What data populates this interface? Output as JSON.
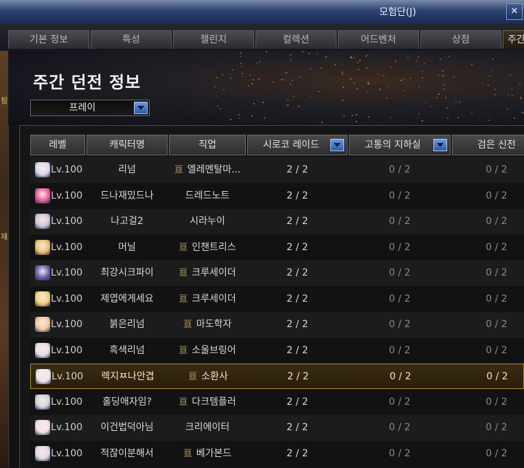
{
  "window": {
    "title": "모험단(J)"
  },
  "tabs": [
    {
      "label": "기본 정보"
    },
    {
      "label": "특성"
    },
    {
      "label": "챌린지"
    },
    {
      "label": "컬렉션"
    },
    {
      "label": "어드벤처"
    },
    {
      "label": "상점"
    },
    {
      "label": "주간"
    }
  ],
  "page": {
    "heading": "주간 던전 정보",
    "filter": {
      "selected": "프레이"
    }
  },
  "table": {
    "columns": [
      "레벨",
      "캐릭터명",
      "직업",
      "시로코 레이드",
      "고통의 지하실",
      "검은 신전"
    ],
    "rows": [
      {
        "level": "Lv.100",
        "name": "리넘",
        "job": "엘레멘탈마...",
        "guild_icon": true,
        "c1": "2 / 2",
        "c2": "0 / 2",
        "c3": "0 / 2",
        "avatar_color": "#d8d8f0"
      },
      {
        "level": "Lv.100",
        "name": "드나재밌드나",
        "job": "드레드노트",
        "guild_icon": false,
        "c1": "2 / 2",
        "c2": "0 / 2",
        "c3": "0 / 2",
        "avatar_color": "#e060a0"
      },
      {
        "level": "Lv.100",
        "name": "나고걸2",
        "job": "시라누이",
        "guild_icon": false,
        "c1": "2 / 2",
        "c2": "0 / 2",
        "c3": "0 / 2",
        "avatar_color": "#c8c8e0"
      },
      {
        "level": "Lv.100",
        "name": "머닐",
        "job": "인챈트리스",
        "guild_icon": true,
        "c1": "2 / 2",
        "c2": "0 / 2",
        "c3": "0 / 2",
        "avatar_color": "#e8c070"
      },
      {
        "level": "Lv.100",
        "name": "최강시크파이",
        "job": "크루세이더",
        "guild_icon": true,
        "c1": "2 / 2",
        "c2": "0 / 2",
        "c3": "0 / 2",
        "avatar_color": "#6060b0"
      },
      {
        "level": "Lv.100",
        "name": "제엽에게세요",
        "job": "크루세이더",
        "guild_icon": true,
        "c1": "2 / 2",
        "c2": "0 / 2",
        "c3": "0 / 2",
        "avatar_color": "#f0d080"
      },
      {
        "level": "Lv.100",
        "name": "붉은리넘",
        "job": "마도학자",
        "guild_icon": true,
        "c1": "2 / 2",
        "c2": "0 / 2",
        "c3": "0 / 2",
        "avatar_color": "#f0c8a0"
      },
      {
        "level": "Lv.100",
        "name": "흑색리넘",
        "job": "소울브링어",
        "guild_icon": true,
        "c1": "2 / 2",
        "c2": "0 / 2",
        "c3": "0 / 2",
        "avatar_color": "#e0e0e8"
      },
      {
        "level": "Lv.100",
        "name": "렉지ㅉ나안겹",
        "job": "소환사",
        "guild_icon": true,
        "c1": "2 / 2",
        "c2": "0 / 2",
        "c3": "0 / 2",
        "avatar_color": "#e8e8f0",
        "selected": true
      },
      {
        "level": "Lv.100",
        "name": "홀딩애자임?",
        "job": "다크템플러",
        "guild_icon": true,
        "c1": "2 / 2",
        "c2": "0 / 2",
        "c3": "0 / 2",
        "avatar_color": "#d0d0e8"
      },
      {
        "level": "Lv.100",
        "name": "이건법덕아님",
        "job": "크리에이터",
        "guild_icon": false,
        "c1": "2 / 2",
        "c2": "0 / 2",
        "c3": "0 / 2",
        "avatar_color": "#f0e0e8"
      },
      {
        "level": "Lv.100",
        "name": "적잖이분해서",
        "job": "베가본드",
        "guild_icon": true,
        "c1": "2 / 2",
        "c2": "0 / 2",
        "c3": "0 / 2",
        "avatar_color": "#e0d8f0"
      }
    ]
  },
  "icons": {
    "dropdown": "chevron-down-icon",
    "guild": "guild-emblem-icon",
    "close": "close-icon"
  }
}
